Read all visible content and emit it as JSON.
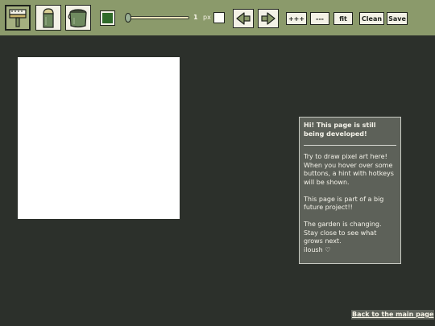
{
  "toolbar": {
    "tools": [
      {
        "name": "brush",
        "icon": "paintbrush-icon",
        "selected": true
      },
      {
        "name": "eraser",
        "icon": "eraser-icon",
        "selected": false
      },
      {
        "name": "fill",
        "icon": "paint-bucket-icon",
        "selected": false
      }
    ],
    "current_color": "#2f6a2a",
    "brush_size": {
      "value": "1",
      "unit": "px",
      "slider_level": 0
    },
    "undo_icon": "undo-arrow-icon",
    "redo_icon": "redo-arrow-icon",
    "zoom_in_label": "+++",
    "zoom_out_label": "---",
    "fit_label": "fit",
    "clean_label": "Clean",
    "save_label": "Save"
  },
  "info_panel": {
    "heading": "Hi! This page is still being developed!",
    "paragraph1": "Try to draw pixel art here! When you hover over some buttons, a hint with hotkeys will be shown.",
    "paragraph2": "This page is part of a big future project!!",
    "paragraph3": "The garden is changing. Stay close to see what grows next.",
    "signature": "iloush ♡"
  },
  "footer": {
    "back_link": "Back to the main page"
  },
  "colors": {
    "background": "#2c302b",
    "toolbar": "#8b9a6b",
    "panel": "#5d6159"
  }
}
